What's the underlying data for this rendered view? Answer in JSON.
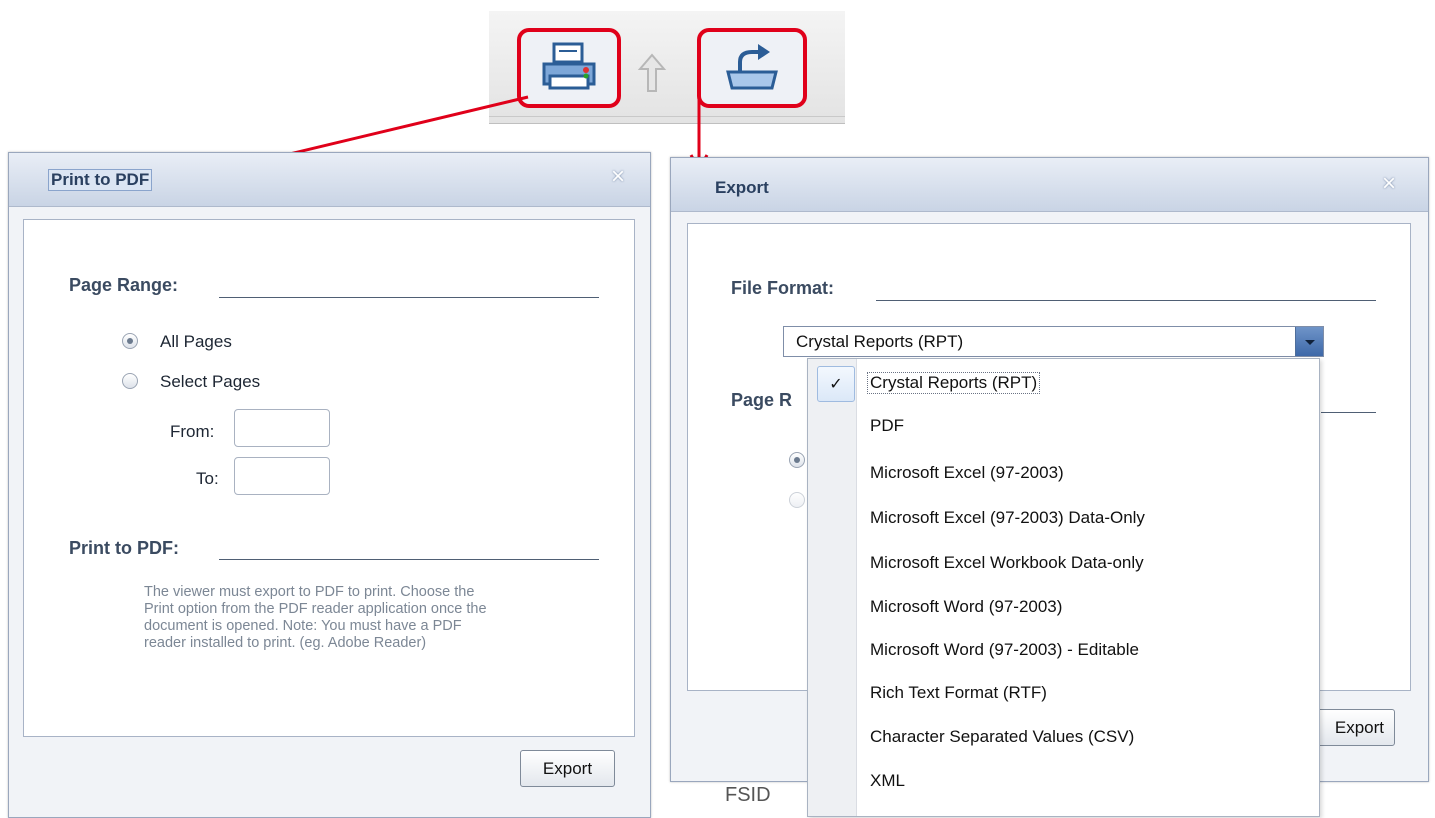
{
  "toolbar": {
    "print_icon": "printer-icon",
    "up_icon": "up-arrow-icon",
    "export_icon": "export-tray-icon"
  },
  "print_dialog": {
    "title": "Print to PDF",
    "close_glyph": "×",
    "page_range_label": "Page Range:",
    "all_pages_label": "All Pages",
    "select_pages_label": "Select Pages",
    "from_label": "From:",
    "to_label": "To:",
    "from_value": "",
    "to_value": "",
    "print_section_label": "Print to PDF:",
    "note_lines": [
      "The viewer must export to PDF to print. Choose the",
      "Print option from the PDF reader application once the",
      "document is opened. Note: You must have a PDF",
      "reader installed to print. (eg. Adobe Reader)"
    ],
    "export_button": "Export"
  },
  "export_dialog": {
    "title": "Export",
    "close_glyph": "×",
    "file_format_label": "File Format:",
    "selected_format": "Crystal Reports (RPT)",
    "page_range_label_partial": "Page R",
    "export_button_partial": "Export",
    "background_text": "FSID",
    "formats": [
      "Crystal Reports (RPT)",
      "PDF",
      "Microsoft Excel (97-2003)",
      "Microsoft Excel (97-2003) Data-Only",
      "Microsoft Excel Workbook Data-only",
      "Microsoft Word (97-2003)",
      "Microsoft Word (97-2003) - Editable",
      "Rich Text Format (RTF)",
      "Character Separated Values (CSV)",
      "XML"
    ],
    "check_glyph": "✓"
  },
  "colors": {
    "highlight": "#e0001a",
    "title_text": "#2a4060",
    "section_text": "#3b4b61"
  }
}
